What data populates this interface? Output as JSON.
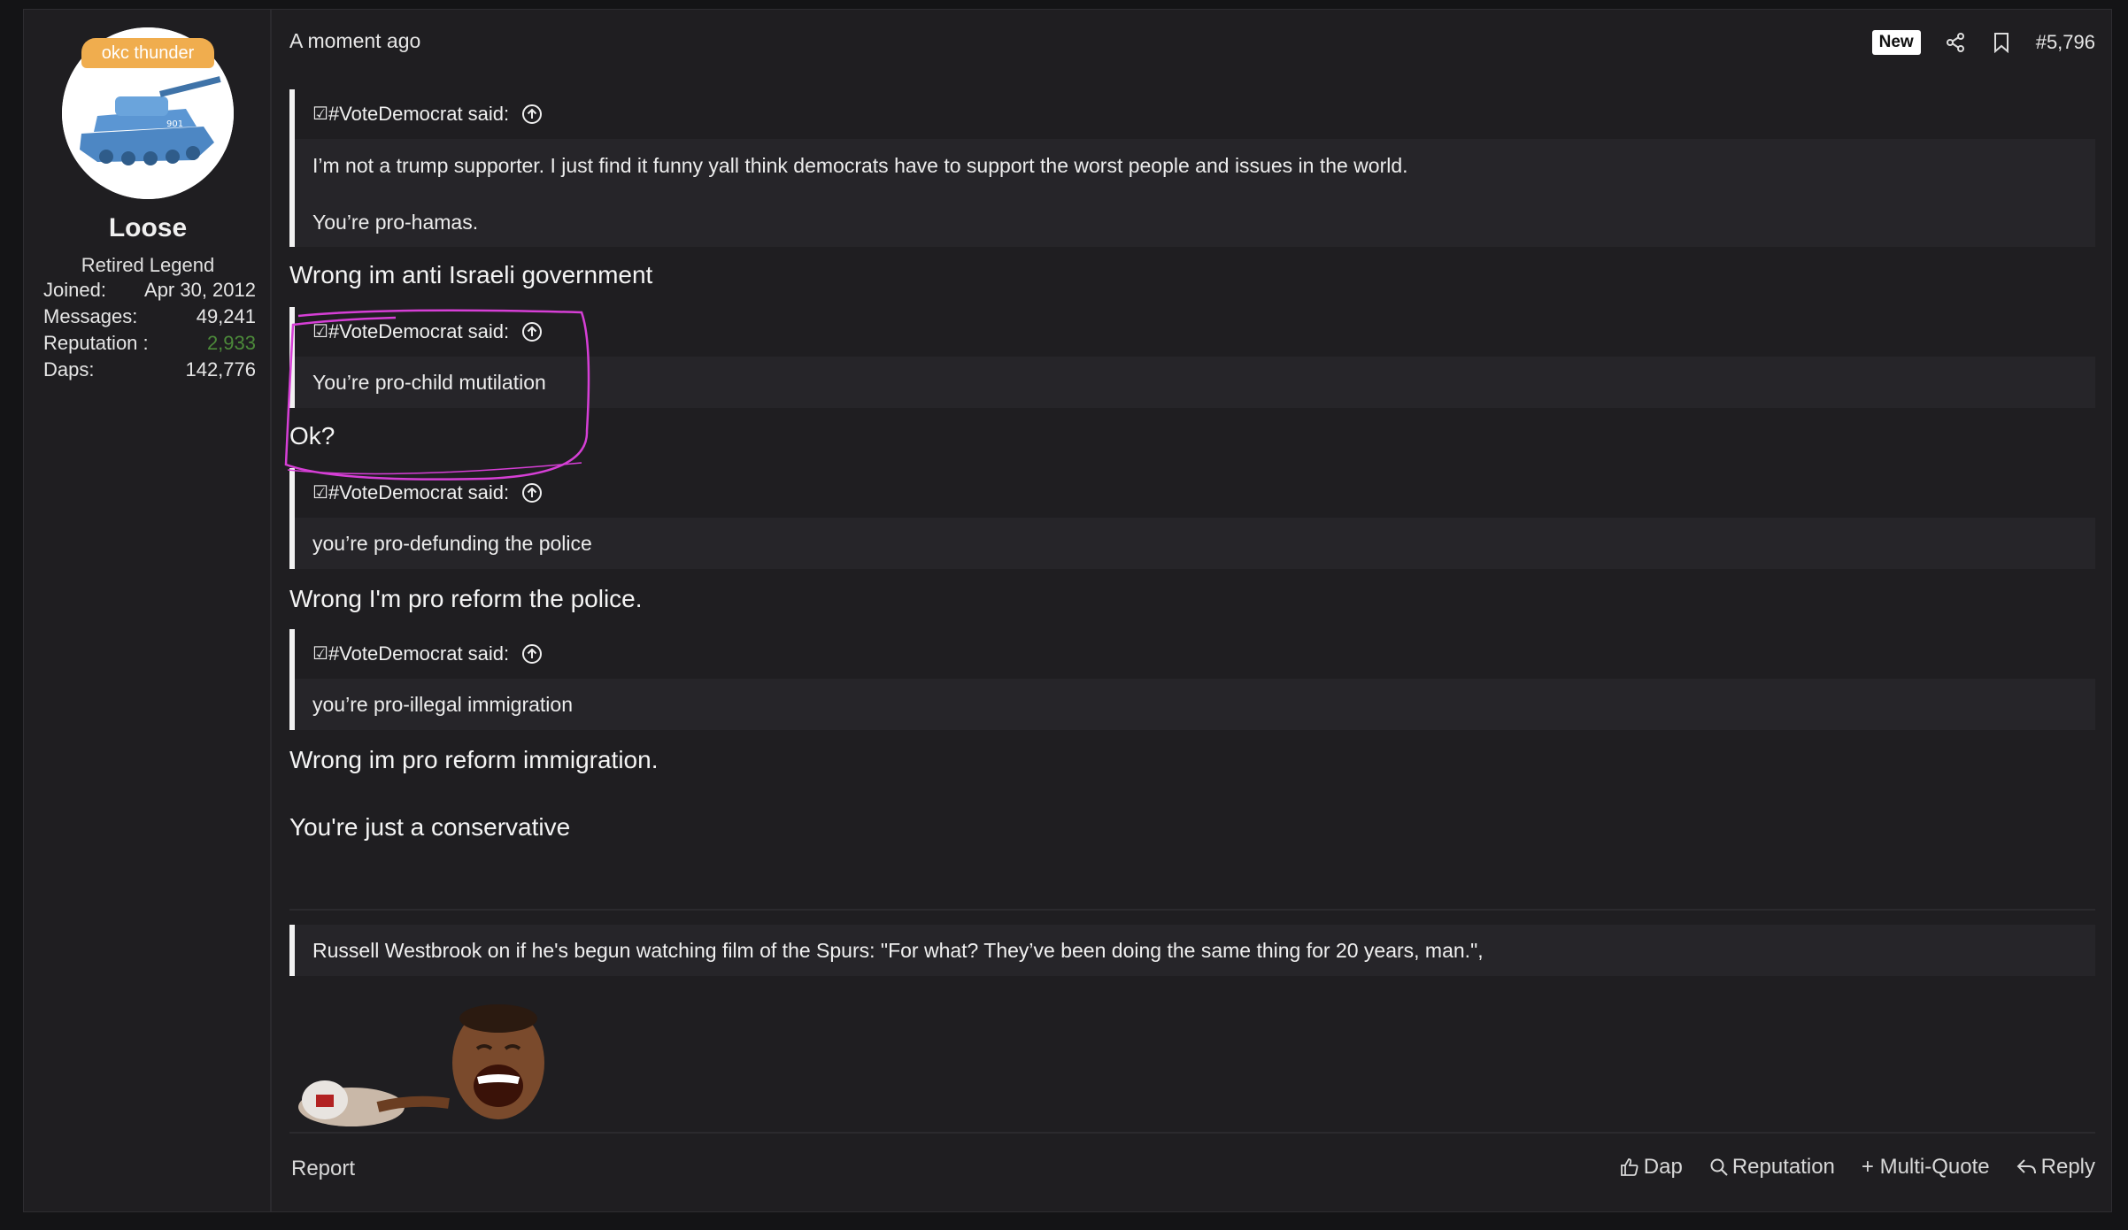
{
  "user": {
    "banner": "okc thunder",
    "name": "Loose",
    "title": "Retired Legend",
    "stats": [
      {
        "label": "Joined:",
        "value": "Apr 30, 2012"
      },
      {
        "label": "Messages:",
        "value": "49,241"
      },
      {
        "label": "Reputation :",
        "value": "2,933"
      },
      {
        "label": "Daps:",
        "value": "142,776"
      }
    ]
  },
  "header": {
    "time": "A moment ago",
    "new_badge": "New",
    "post_number": "#5,796"
  },
  "quotes": [
    {
      "author": "#VoteDemocrat said:",
      "check": "☑",
      "lines": [
        "I’m not a trump supporter. I just find it funny yall think democrats have to support the worst people and issues in the world.",
        "You’re pro-hamas."
      ]
    },
    {
      "author": "#VoteDemocrat said:",
      "check": "☑",
      "lines": [
        "You’re pro-child mutilation"
      ]
    },
    {
      "author": "#VoteDemocrat said:",
      "check": "☑",
      "lines": [
        "you’re pro-defunding the police"
      ]
    },
    {
      "author": "#VoteDemocrat said:",
      "check": "☑",
      "lines": [
        "you’re pro-illegal immigration"
      ]
    }
  ],
  "replies": [
    "Wrong im anti Israeli government",
    "Ok?",
    "Wrong I'm pro reform the police.",
    "Wrong im pro reform immigration.",
    "You're just a conservative"
  ],
  "signature": "Russell Westbrook on if he's begun watching film of the Spurs: \"For what? They’ve been doing the same thing for 20 years, man.\",",
  "footer": {
    "report": "Report",
    "dap": "Dap",
    "reputation": "Reputation",
    "multi_quote": "+ Multi-Quote",
    "reply": "Reply"
  },
  "colors": {
    "background": "#1f1e21",
    "quote_bar": "#f2f2f2",
    "reputation": "#4c8a3a",
    "banner": "#f0ad4e",
    "highlight": "#d63fd6"
  }
}
